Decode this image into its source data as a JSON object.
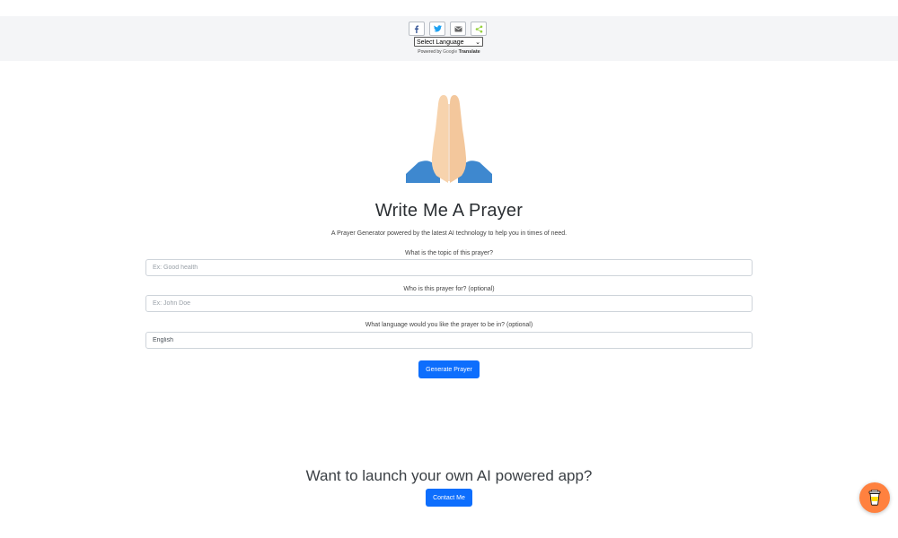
{
  "share": {
    "buttons": [
      {
        "name": "facebook",
        "glyph": "f",
        "color": "#3b5998"
      },
      {
        "name": "twitter",
        "glyph": "🐦",
        "color": "#1da1f2"
      },
      {
        "name": "email",
        "glyph": "✉",
        "color": "#555555"
      },
      {
        "name": "share",
        "glyph": "<",
        "color": "#95d03a"
      }
    ]
  },
  "translate": {
    "select_label": "Select Language",
    "powered_by": "Powered by",
    "google": "Google",
    "translate": "Translate"
  },
  "main": {
    "title": "Write Me A Prayer",
    "subtitle": "A Prayer Generator powered by the latest AI technology to help you in times of need.",
    "fields": {
      "topic": {
        "label": "What is the topic of this prayer?",
        "placeholder": "Ex: Good health",
        "value": ""
      },
      "recipient": {
        "label": "Who is this prayer for? (optional)",
        "placeholder": "Ex: John Doe",
        "value": ""
      },
      "language": {
        "label": "What language would you like the prayer to be in? (optional)",
        "placeholder": "",
        "value": "English"
      }
    },
    "generate_label": "Generate Prayer"
  },
  "footer": {
    "cta_text": "Want to launch your own AI powered app?",
    "contact_label": "Contact Me"
  },
  "colors": {
    "primary": "#0d6efd",
    "coffee": "#ff813f",
    "skin": "#f7d6b3",
    "sleeve": "#4a90d9"
  }
}
